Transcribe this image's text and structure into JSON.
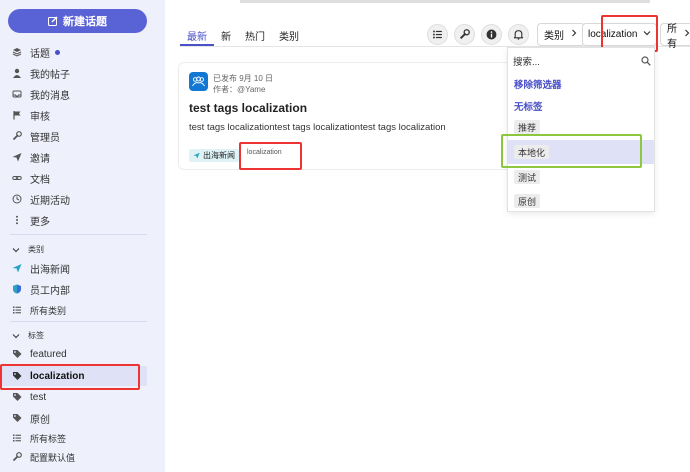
{
  "sidebar": {
    "new_topic": "新建话题",
    "nav": [
      {
        "label": "话题",
        "icon": "layers-icon"
      },
      {
        "label": "我的帖子",
        "icon": "user-icon"
      },
      {
        "label": "我的消息",
        "icon": "inbox-icon"
      },
      {
        "label": "审核",
        "icon": "flag-icon"
      },
      {
        "label": "管理员",
        "icon": "wrench-icon"
      },
      {
        "label": "邀请",
        "icon": "send-icon"
      },
      {
        "label": "文档",
        "icon": "link-icon"
      },
      {
        "label": "近期活动",
        "icon": "history-icon"
      },
      {
        "label": "更多",
        "icon": "more-vertical-icon"
      }
    ],
    "categories_header": "类别",
    "categories": [
      {
        "label": "出海新闻",
        "icon": "paper-plane-icon"
      },
      {
        "label": "员工内部",
        "icon": "shield-icon"
      },
      {
        "label": "所有类别",
        "icon": "list-icon"
      }
    ],
    "tags_header": "标签",
    "tags": [
      {
        "label": "featured"
      },
      {
        "label": "localization"
      },
      {
        "label": "test"
      },
      {
        "label": "原创"
      }
    ],
    "all_tags": "所有标签",
    "configure_defaults": "配置默认值"
  },
  "tabs": [
    "最新",
    "新",
    "热门",
    "类别"
  ],
  "toolbar": {
    "category_filter": "类别",
    "tag_filter": "localization",
    "all_filter": "所有"
  },
  "topic": {
    "published": "已发布 9月 10 日",
    "author": "作者：@Yame",
    "title": "test tags localization",
    "excerpt": "test tags localizationtest tags localizationtest tags localization",
    "category": "出海新闻",
    "tag": "localization"
  },
  "dropdown": {
    "search_placeholder": "搜索...",
    "remove_filter": "移除筛选器",
    "no_tags": "无标签",
    "tags": [
      "推荐",
      "本地化",
      "测试",
      "原创"
    ]
  },
  "colors": {
    "accent": "#4a50c8",
    "primary_button": "#5a63d6",
    "sidebar_bg": "#eef0fb",
    "highlight_red": "#e33333",
    "highlight_green": "#8dc63f"
  }
}
